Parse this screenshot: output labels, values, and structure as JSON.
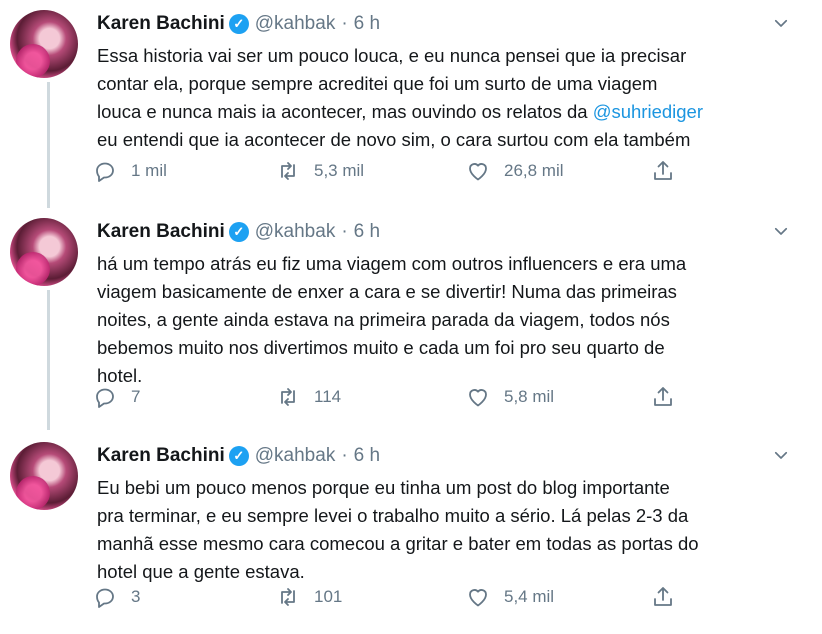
{
  "tweets": [
    {
      "author": {
        "name": "Karen Bachini",
        "handle": "@kahbak",
        "separator": "·",
        "time": "6 h"
      },
      "lines": [
        "Essa historia vai ser um pouco louca, e eu nunca pensei que ia precisar",
        "contar ela, porque sempre acreditei que foi um surto de uma viagem",
        "louca e nunca mais ia acontecer, mas ouvindo os relatos da ",
        "eu entendi que ia acontecer de novo sim, o cara surtou com ela também"
      ],
      "mention": "@suhriediger",
      "stats": {
        "replies": "1 mil",
        "retweets": "5,3 mil",
        "likes": "26,8 mil"
      }
    },
    {
      "author": {
        "name": "Karen Bachini",
        "handle": "@kahbak",
        "separator": "·",
        "time": "6 h"
      },
      "lines": [
        "há um tempo atrás eu fiz uma viagem com outros influencers e era uma",
        "viagem basicamente de enxer a cara e se divertir! Numa das primeiras",
        "noites, a gente ainda estava na primeira parada da viagem, todos nós",
        "bebemos muito nos divertimos muito e cada um foi pro seu quarto de",
        "hotel."
      ],
      "stats": {
        "replies": "7",
        "retweets": "114",
        "likes": "5,8 mil"
      }
    },
    {
      "author": {
        "name": "Karen Bachini",
        "handle": "@kahbak",
        "separator": "·",
        "time": "6 h"
      },
      "lines": [
        "Eu bebi um pouco menos porque eu tinha um post do blog importante",
        "pra terminar, e eu sempre levei o trabalho muito a sério. Lá pelas 2-3 da",
        "manhã esse mesmo cara comecou a gritar e bater em todas as portas do",
        "hotel que a gente estava."
      ],
      "stats": {
        "replies": "3",
        "retweets": "101",
        "likes": "5,4 mil"
      }
    }
  ],
  "icons": {
    "verified": "verified-badge-icon",
    "menu": "chevron-down-icon",
    "reply": "reply-icon",
    "retweet": "retweet-icon",
    "like": "heart-icon",
    "share": "share-icon"
  },
  "colors": {
    "mention": "#1b95e0",
    "secondary_text": "#657786",
    "verified": "#1da1f2"
  }
}
